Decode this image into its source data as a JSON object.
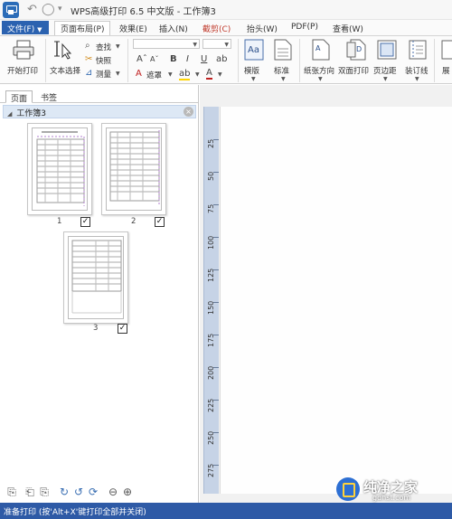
{
  "window": {
    "title": "WPS高级打印 6.5 中文版 - 工作簿3"
  },
  "tabs": {
    "file": "文件(F)",
    "items": [
      "页面布局(P)",
      "效果(E)",
      "插入(N)",
      "截剪(C)",
      "抬头(W)",
      "PDF(P)",
      "查看(W)"
    ],
    "active_index": 0
  },
  "ribbon": {
    "start_print": "开始打印",
    "text_select": "文本选择",
    "find": "查找",
    "snapshot": "快照",
    "measure": "测量",
    "shade": "遮罩",
    "template": "模版",
    "standard": "标准",
    "paper_direction": "纸张方向",
    "duplex_print": "双面打印",
    "margins": "页边距",
    "binding_line": "装订线",
    "overflow": "展"
  },
  "panel": {
    "tab_pages": "页面",
    "tab_bookmarks": "书签",
    "workbook": "工作簿3",
    "pages": [
      {
        "label": "1",
        "checked": "✓"
      },
      {
        "label": "2",
        "checked": "✓"
      },
      {
        "label": "3",
        "checked": "✓"
      }
    ]
  },
  "ruler": {
    "marks": [
      "25",
      "50",
      "75",
      "100",
      "125",
      "150",
      "175",
      "200",
      "225",
      "250",
      "275"
    ]
  },
  "status": {
    "text": "准备打印 (按'Alt+X'键打印全部并关闭)"
  },
  "watermark": {
    "text": "纯净之家",
    "sub": "gdhst.com"
  },
  "colors": {
    "accent": "#2b62b0",
    "status_bar": "#2e5aa6",
    "ruler": "#c6d3e6",
    "panel_header": "#dde8f5"
  }
}
